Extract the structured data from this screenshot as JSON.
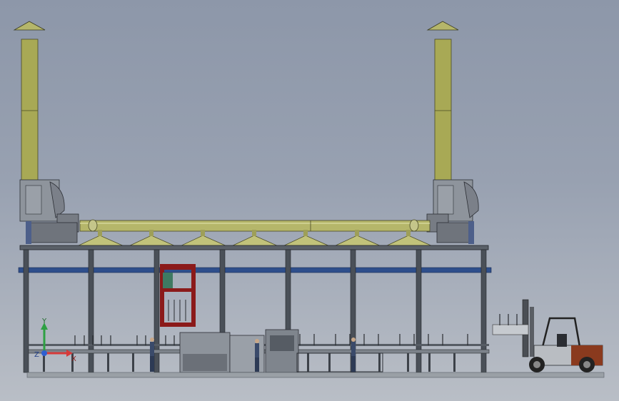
{
  "scene": {
    "description_free": true,
    "colors": {
      "background_top": "#8d97a9",
      "background_bottom": "#b9bec6",
      "duct": "#b5b66a",
      "duct_dark": "#7a7b3e",
      "steel": "#3a3f47",
      "blue_beam": "#2e4f8c",
      "red_frame": "#8b1a1a",
      "forklift_body": "#c0c4c8",
      "forklift_accent": "#8a3a1e"
    }
  },
  "coordinate_triad": {
    "y_label": "Y",
    "z_label": "Z",
    "x_label": "X",
    "y_color": "#2ea043",
    "x_color": "#d63a3a",
    "z_color": "#2f5fd0"
  }
}
